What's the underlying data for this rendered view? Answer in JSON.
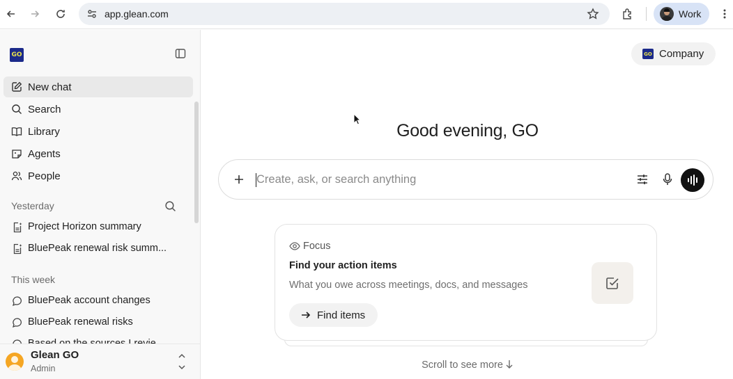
{
  "browser": {
    "url": "app.glean.com",
    "profile_label": "Work"
  },
  "sidebar": {
    "logo_text": "GO",
    "nav": [
      {
        "label": "New chat",
        "icon": "edit-icon"
      },
      {
        "label": "Search",
        "icon": "search-icon"
      },
      {
        "label": "Library",
        "icon": "book-icon"
      },
      {
        "label": "Agents",
        "icon": "agent-icon"
      },
      {
        "label": "People",
        "icon": "people-icon"
      }
    ],
    "sections": [
      {
        "label": "Yesterday",
        "items": [
          "Project Horizon summary",
          "BluePeak renewal risk summ..."
        ]
      },
      {
        "label": "This week",
        "items": [
          "BluePeak account changes",
          "BluePeak renewal risks",
          "Based on the sources I revie..."
        ]
      }
    ],
    "user": {
      "name": "Glean GO",
      "role": "Admin"
    }
  },
  "main": {
    "company_label": "Company",
    "greeting": "Good evening, GO",
    "composer_placeholder": "Create, ask, or search anything",
    "card": {
      "tag": "Focus",
      "title": "Find your action items",
      "description": "What you owe across meetings, docs, and messages",
      "button_label": "Find items"
    },
    "scroll_hint": "Scroll to see more"
  }
}
